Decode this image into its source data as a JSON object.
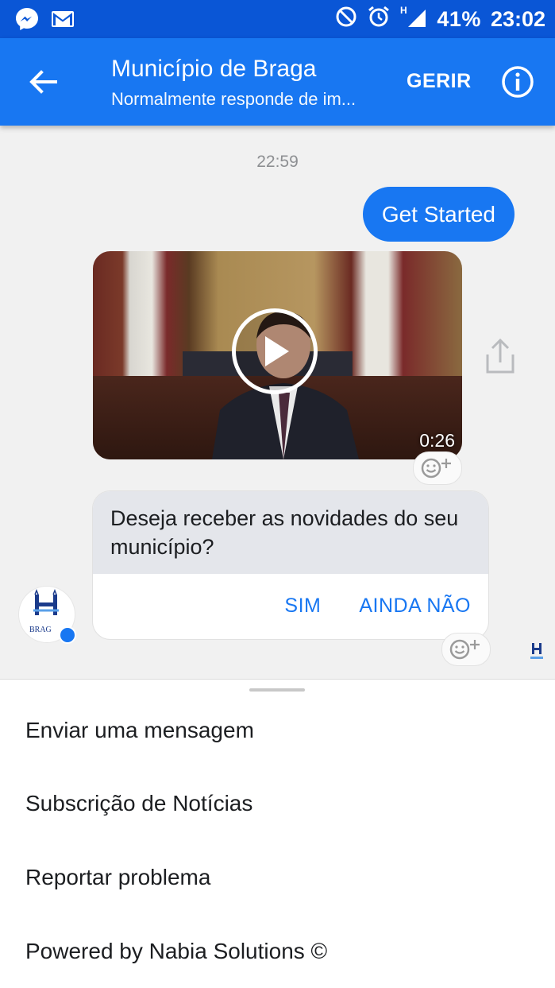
{
  "status_bar": {
    "left_icons": [
      "messenger-icon",
      "gmail-icon"
    ],
    "right_icons": [
      "do-not-disturb-icon",
      "alarm-icon",
      "signal-h-icon"
    ],
    "battery": "41%",
    "time": "23:02"
  },
  "header": {
    "title": "Município de Braga",
    "subtitle": "Normalmente responde de im...",
    "manage_label": "GERIR",
    "back_icon": "arrow-left-icon",
    "info_icon": "info-icon"
  },
  "chat": {
    "timestamp": "22:59",
    "outgoing_message": "Get Started",
    "video": {
      "duration": "0:26",
      "play_icon": "play-icon",
      "share_icon": "share-icon"
    },
    "incoming_message": "Deseja receber as novidades do seu município?",
    "quick_replies": [
      "SIM",
      "AINDA NÃO"
    ],
    "avatar_caption": "BRAG"
  },
  "menu": {
    "items": [
      "Enviar uma mensagem",
      "Subscrição de Notícias",
      "Reportar problema",
      "Powered by Nabia Solutions ©"
    ]
  },
  "colors": {
    "status_bar": "#0a56d6",
    "app_bar": "#1877f2",
    "chat_background": "#f1f1f1",
    "quick_reply_text": "#1877f2"
  }
}
